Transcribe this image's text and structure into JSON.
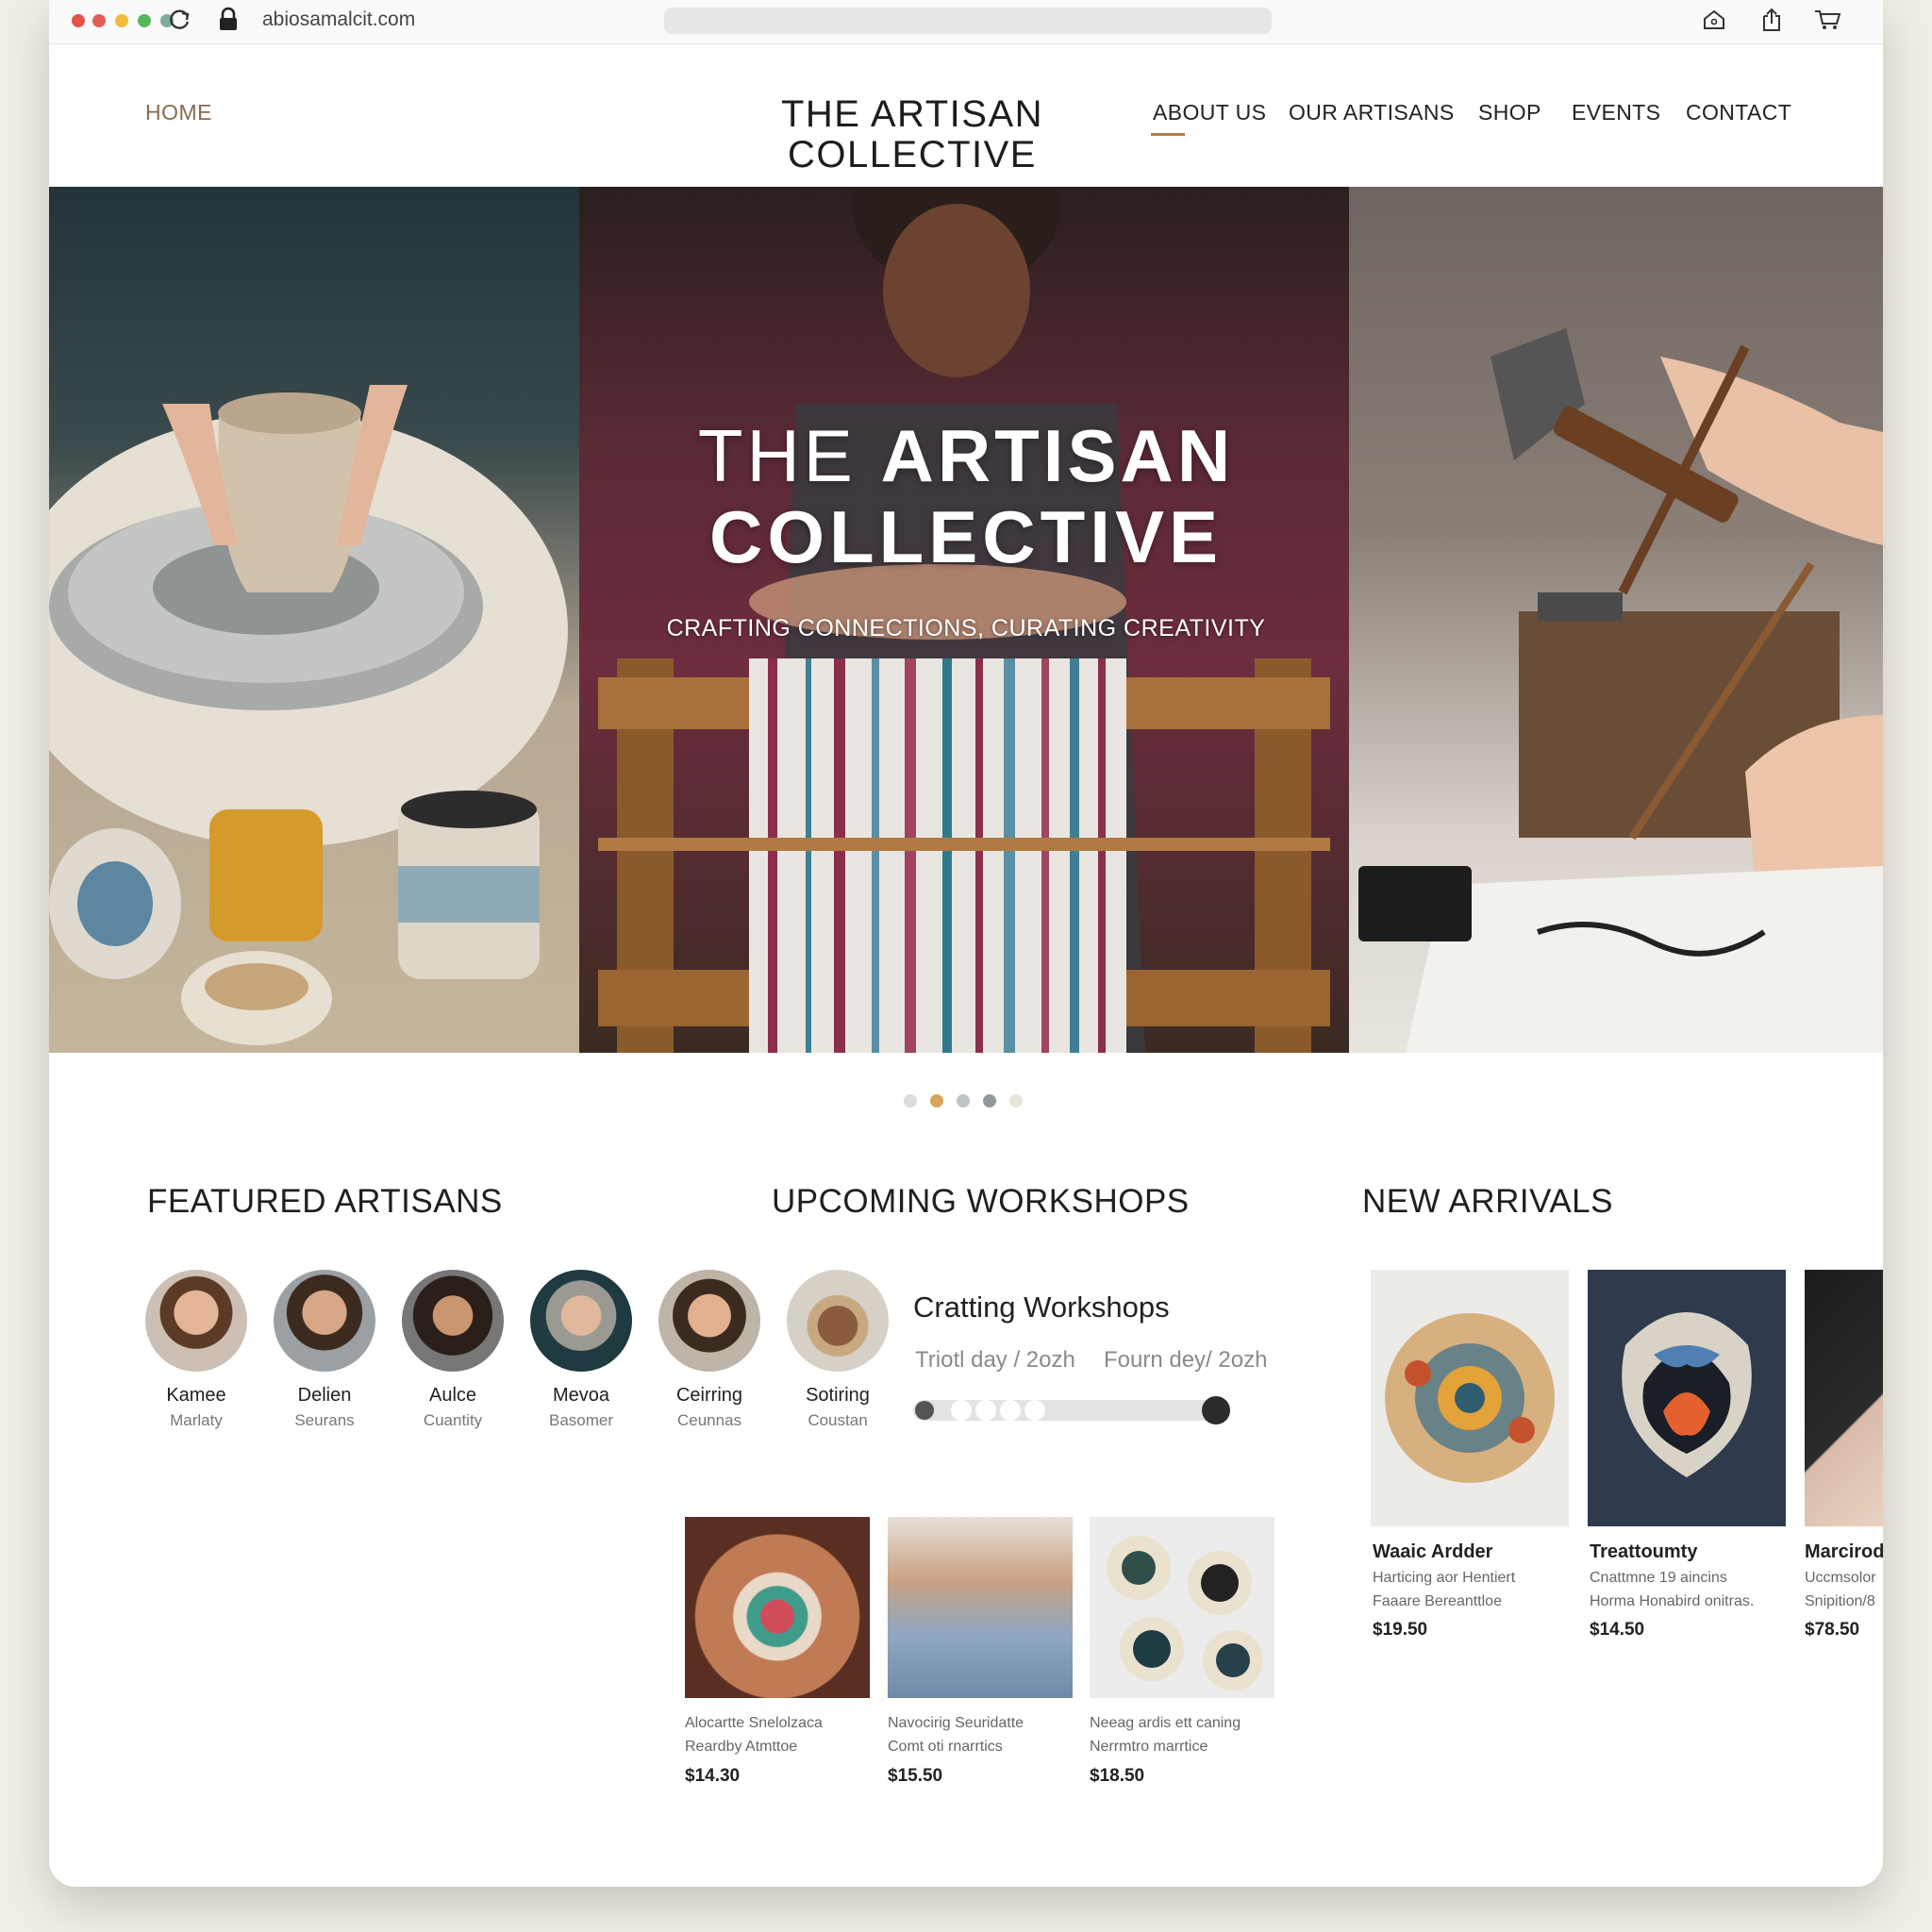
{
  "browser": {
    "url": "abiosamalcit.com"
  },
  "header": {
    "home": "HOME",
    "logo_line1": "THE ARTISAN",
    "logo_line2": "COLLECTIVE",
    "nav": [
      {
        "label": "ABOUT US",
        "active": true
      },
      {
        "label": "OUR ARTISANS"
      },
      {
        "label": "SHOP"
      },
      {
        "label": "EVENTS"
      },
      {
        "label": "CONTACT"
      }
    ]
  },
  "hero": {
    "title_thin": "THE",
    "title_bold": "ARTISAN",
    "title_line2": "COLLECTIVE",
    "tagline": "CRAFTING CONNECTIONS, CURATING CREATIVITY",
    "slide_count": 5,
    "active_slide": 2
  },
  "featured": {
    "title": "FEATURED ARTISANS",
    "artisans": [
      {
        "name": "Kamee",
        "role": "Marlaty"
      },
      {
        "name": "Delien",
        "role": "Seurans"
      },
      {
        "name": "Aulce",
        "role": "Cuantity"
      },
      {
        "name": "Mevoa",
        "role": "Basomer"
      },
      {
        "name": "Ceirring",
        "role": "Ceunnas"
      },
      {
        "name": "Sotiring",
        "role": "Coustan"
      }
    ]
  },
  "workshops": {
    "title": "UPCOMING WORKSHOPS",
    "workshop_title": "Cratting Workshops",
    "date1": "Triotl day / 2ozh",
    "date2": "Fourn dey/ 2ozh",
    "cards": [
      {
        "desc1": "Alocartte Snelolzaca",
        "desc2": "Reardby Atmttoe",
        "price": "$14.30"
      },
      {
        "desc1": "Navocirig Seuridatte",
        "desc2": "Comt oti rnarrtics",
        "price": "$15.50"
      },
      {
        "desc1": "Neeag ardis ett caning",
        "desc2": "Nerrmtro marrtice",
        "price": "$18.50"
      }
    ]
  },
  "arrivals": {
    "title": "NEW ARRIVALS",
    "products": [
      {
        "name": "Waaic Ardder",
        "desc1": "Harticing aor Hentiert",
        "desc2": "Faaare Bereanttloe",
        "price": "$19.50"
      },
      {
        "name": "Treattoumty",
        "desc1": "Cnattmne 19 aincins",
        "desc2": "Horma Honabird onitras.",
        "price": "$14.50"
      },
      {
        "name": "Marcirod",
        "desc1": "Uccmsolor",
        "desc2": "Snipition/8",
        "price": "$78.50"
      }
    ]
  },
  "colors": {
    "accent": "#b97b45",
    "dot_active": "#d9a45c",
    "dot_inactive": "#cfcfcf",
    "dot_dark": "#8e9a9c"
  }
}
